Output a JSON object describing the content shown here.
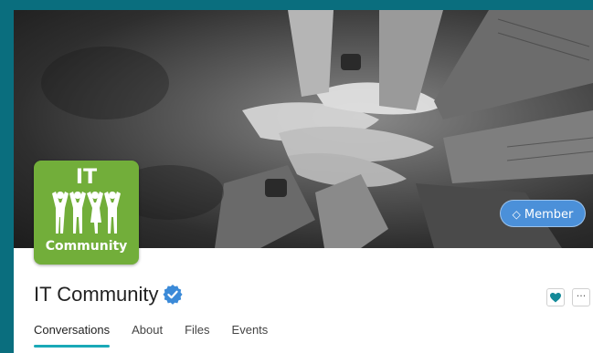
{
  "group": {
    "title": "IT Community",
    "logo_top": "IT",
    "logo_bottom": "Community"
  },
  "membership": {
    "label": "Member"
  },
  "tabs": [
    {
      "label": "Conversations"
    },
    {
      "label": "About"
    },
    {
      "label": "Files"
    },
    {
      "label": "Events"
    }
  ],
  "actions": {
    "more_label": "···"
  },
  "colors": {
    "frame": "#0a6e7e",
    "logo_bg": "#72ae3a",
    "member_btn": "#4b90d9",
    "tab_underline": "#1aa9b7",
    "heart": "#148a99",
    "verified": "#3b8ad8"
  },
  "icons": {
    "verified": "verified-badge-icon",
    "heart": "heart-icon",
    "member": "diamond-arrow-icon",
    "logo": "people-group-icon"
  }
}
